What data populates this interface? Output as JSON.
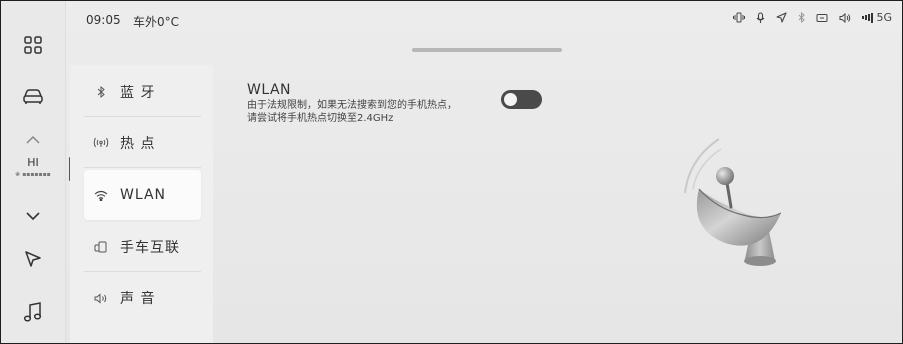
{
  "status": {
    "time": "09:05",
    "outside_temp": "车外0°C",
    "network": "5G"
  },
  "rail": {
    "items": [
      {
        "icon": "apps-grid-icon"
      },
      {
        "icon": "car-icon"
      },
      {
        "icon": "chevron-up-icon"
      },
      {
        "icon": "chevron-down-icon"
      },
      {
        "icon": "navigation-icon"
      },
      {
        "icon": "music-icon"
      }
    ],
    "fan_label": "HI",
    "fan_level_text": "❀ ▪▪▪▪▪▪▪"
  },
  "menu": {
    "items": [
      {
        "label": "蓝 牙",
        "icon": "bluetooth-icon"
      },
      {
        "label": "热 点",
        "icon": "hotspot-icon"
      },
      {
        "label": "WLAN",
        "icon": "wifi-icon",
        "active": true
      },
      {
        "label": "手车互联",
        "icon": "phone-car-link-icon"
      },
      {
        "label": "声 音",
        "icon": "speaker-icon"
      }
    ]
  },
  "wlan": {
    "title": "WLAN",
    "description": "由于法规限制，如果无法搜索到您的手机热点，请尝试将手机热点切换至2.4GHz",
    "enabled": false
  },
  "colors": {
    "background": "#e9e9e9",
    "toggle_off": "#4a4a4a",
    "active_item": "#fbfbfb"
  }
}
